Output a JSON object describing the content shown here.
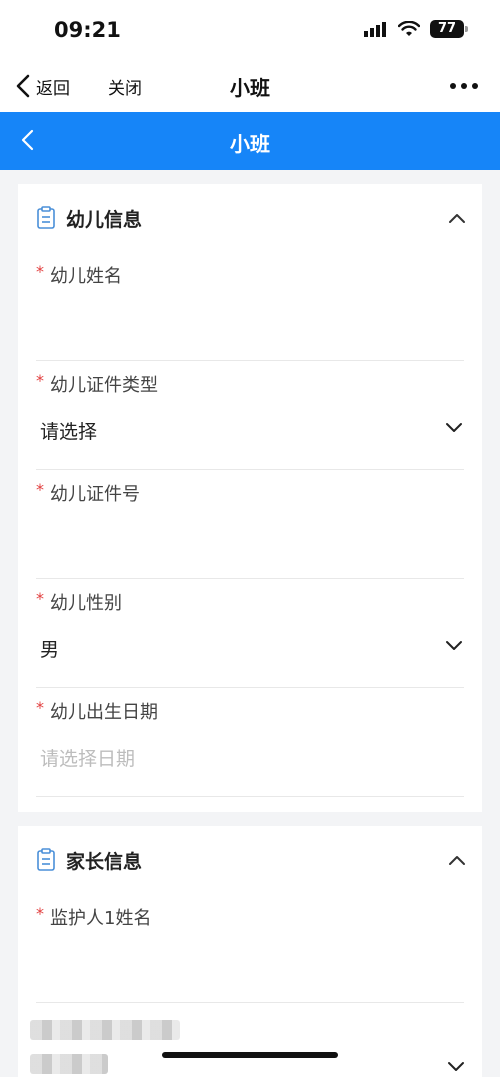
{
  "status_bar": {
    "time": "09:21",
    "battery": "77"
  },
  "nav": {
    "back_label": "返回",
    "close_label": "关闭",
    "title": "小班"
  },
  "header": {
    "title": "小班"
  },
  "child_section": {
    "title": "幼儿信息",
    "fields": [
      {
        "label": "幼儿姓名",
        "value": ""
      },
      {
        "label": "幼儿证件类型",
        "value": "请选择"
      },
      {
        "label": "幼儿证件号",
        "value": ""
      },
      {
        "label": "幼儿性别",
        "value": "男"
      },
      {
        "label": "幼儿出生日期",
        "placeholder": "请选择日期"
      }
    ]
  },
  "parent_section": {
    "title": "家长信息",
    "fields": [
      {
        "label": "监护人1姓名",
        "value": ""
      }
    ]
  },
  "colors": {
    "accent": "#1685f8",
    "required": "#e23d3d"
  }
}
